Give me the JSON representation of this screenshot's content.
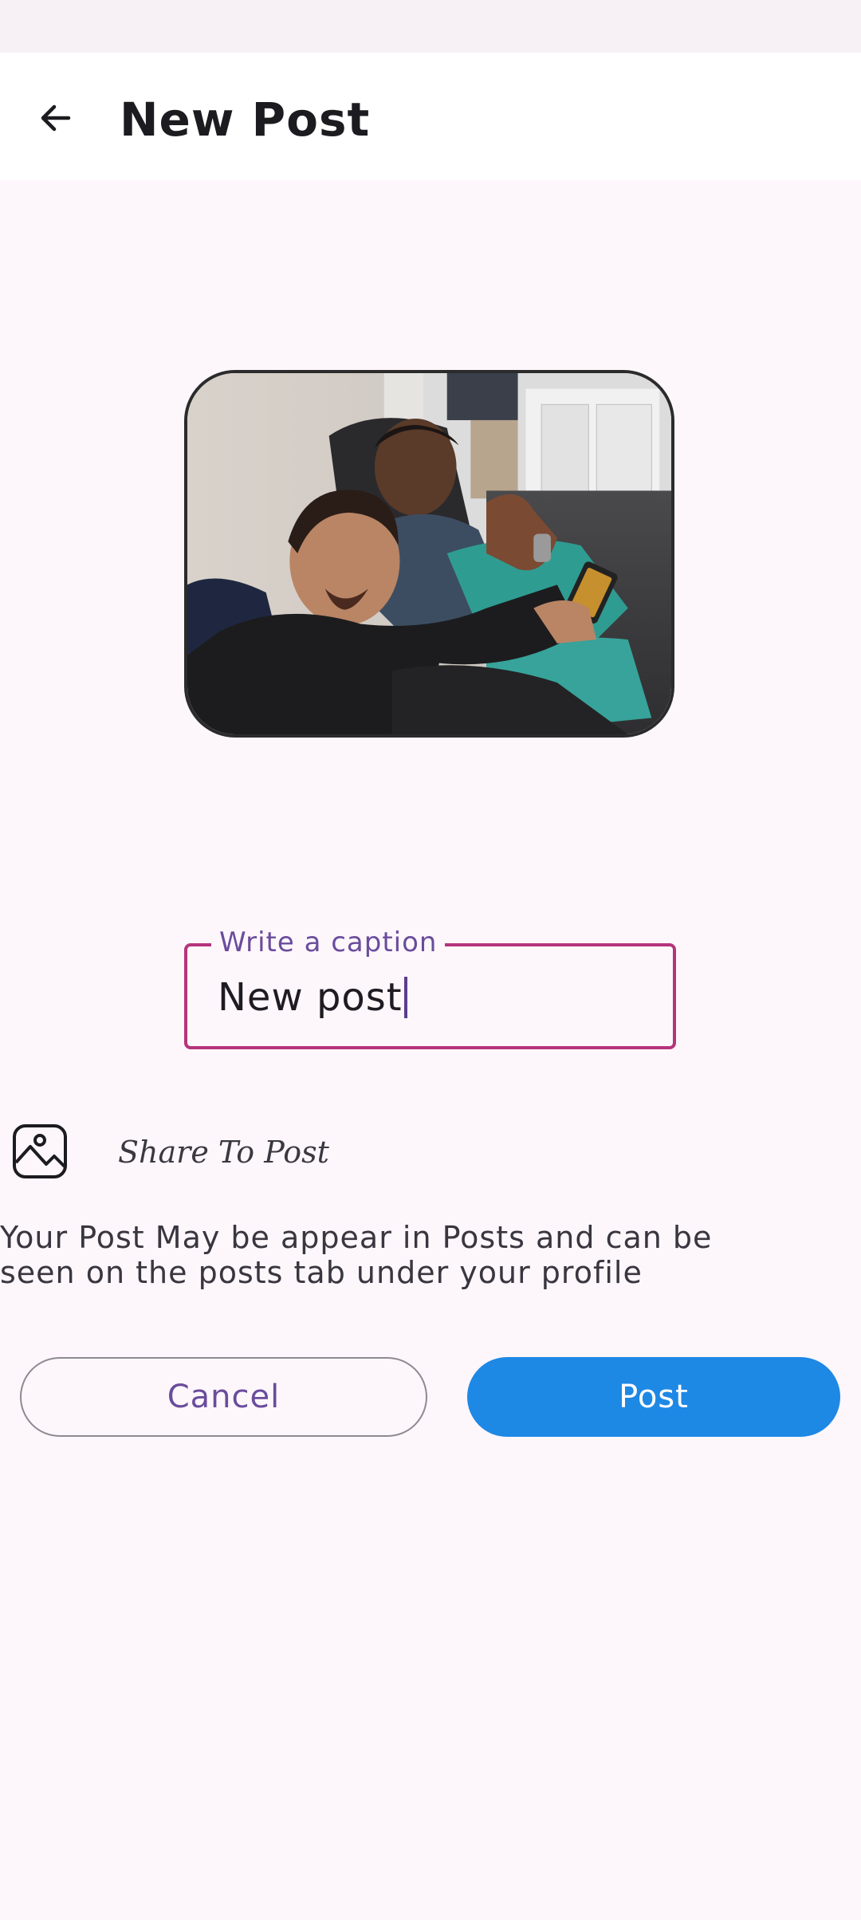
{
  "header": {
    "title": "New Post",
    "back_icon": "arrow-back-icon"
  },
  "photo": {
    "description_icon": "photo-preview"
  },
  "caption": {
    "label": "Write a caption",
    "value": "New post"
  },
  "share": {
    "icon": "image-icon",
    "label": "Share To Post"
  },
  "info": {
    "text": "Your Post May be appear in Posts and can be seen on the posts tab under your profile"
  },
  "actions": {
    "cancel_label": "Cancel",
    "post_label": "Post"
  },
  "colors": {
    "accent": "#1e88e5",
    "caption_border": "#b5347c",
    "label_purple": "#6a4c9c",
    "background": "#fdf7fb"
  }
}
